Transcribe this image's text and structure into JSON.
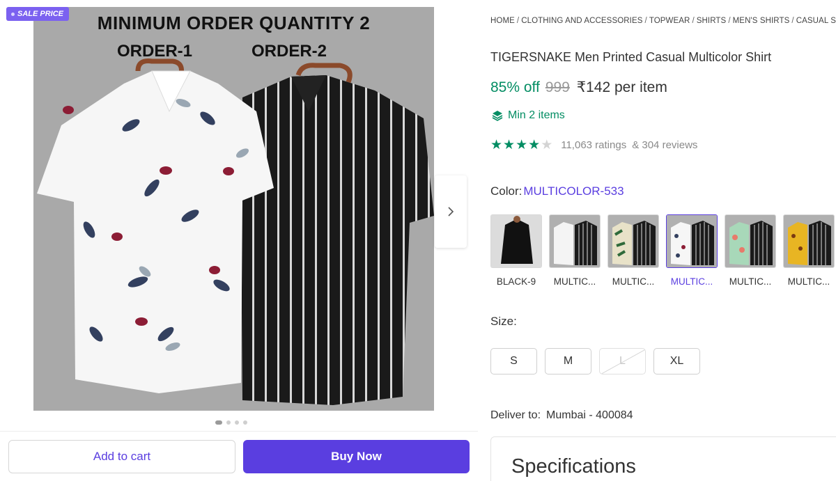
{
  "gallery": {
    "badge": "SALE PRICE",
    "photo_headline": "MINIMUM ORDER QUANTITY  2",
    "photo_label_1": "ORDER-1",
    "photo_label_2": "ORDER-2",
    "next_icon": "chevron-right-icon",
    "carousel_dots": 4,
    "carousel_active": 1
  },
  "actions": {
    "add_to_cart": "Add to cart",
    "buy_now": "Buy Now"
  },
  "breadcrumb": [
    "HOME",
    "CLOTHING AND ACCESSORIES",
    "TOPWEAR",
    "SHIRTS",
    "MEN'S SHIRTS",
    "CASUAL SHIRTS"
  ],
  "product": {
    "title": "TIGERSNAKE Men Printed Casual Multicolor Shirt",
    "discount": "85% off",
    "mrp": "999",
    "price": "₹142 per item",
    "min_items": "Min 2 items",
    "rating_stars": 4,
    "ratings": "11,063 ratings",
    "reviews": "& 304 reviews"
  },
  "color": {
    "label": "Color:",
    "selected": "MULTICOLOR-533",
    "options": [
      {
        "name": "BLACK-9",
        "selected": false
      },
      {
        "name": "MULTIC...",
        "selected": false
      },
      {
        "name": "MULTIC...",
        "selected": false
      },
      {
        "name": "MULTIC...",
        "selected": true
      },
      {
        "name": "MULTIC...",
        "selected": false
      },
      {
        "name": "MULTIC...",
        "selected": false
      }
    ]
  },
  "size": {
    "label": "Size:",
    "options": [
      {
        "name": "S",
        "available": true
      },
      {
        "name": "M",
        "available": true
      },
      {
        "name": "L",
        "available": false
      },
      {
        "name": "XL",
        "available": true
      }
    ]
  },
  "delivery": {
    "label": "Deliver to:",
    "location": "Mumbai - 400084"
  },
  "specifications": {
    "title": "Specifications"
  },
  "colors": {
    "accent": "#5a3ee0",
    "green": "#038d63",
    "badge": "#7b61f0"
  }
}
